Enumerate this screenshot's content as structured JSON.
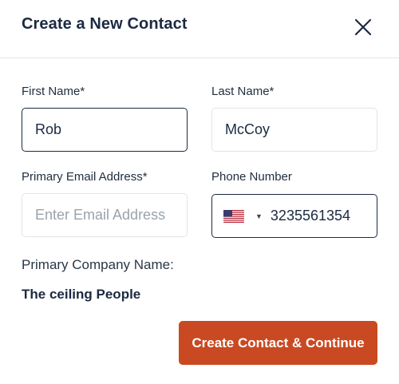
{
  "dialog": {
    "title": "Create a New Contact",
    "close_icon": "close-icon"
  },
  "form": {
    "first_name": {
      "label": "First Name*",
      "value": "Rob"
    },
    "last_name": {
      "label": "Last Name*",
      "value": "McCoy"
    },
    "email": {
      "label": "Primary Email Address*",
      "value": "",
      "placeholder": "Enter Email Address"
    },
    "phone": {
      "label": "Phone Number",
      "country_flag_icon": "us-flag-icon",
      "dropdown_icon": "caret-down-icon",
      "value": "3235561354"
    },
    "company": {
      "label": "Primary Company Name:",
      "value": "The ceiling People"
    }
  },
  "actions": {
    "submit_label": "Create Contact & Continue"
  },
  "colors": {
    "accent": "#c94a22",
    "text_dark": "#1b2a41",
    "border": "#e1e4e8",
    "placeholder": "#9aa3ad"
  }
}
